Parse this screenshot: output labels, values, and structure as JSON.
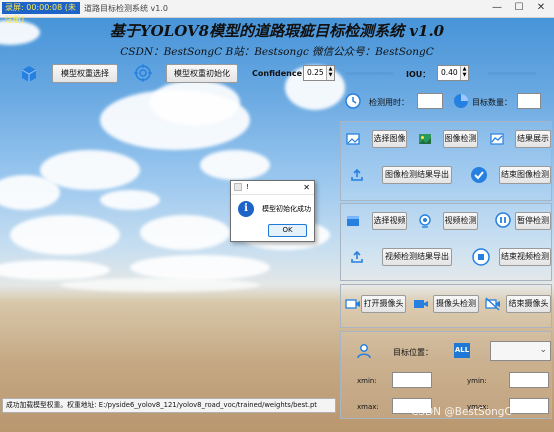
{
  "titlebar": {
    "badge": "录屏: 00:00:08 (未注册)",
    "title": "道路目标检测系统 v1.0",
    "minimize": "—",
    "maximize": "☐",
    "close": "✕"
  },
  "header": {
    "title": "基于YOLOV8模型的道路瑕疵目标检测系统 v1.0",
    "subtitle": "CSDN：BestSongC   B站：Bestsongc   微信公众号：BestSongC"
  },
  "toolbar": {
    "select_weights": "模型权重选择",
    "init_weights": "模型权重初始化",
    "confidence_label": "Confidence",
    "confidence_value": "0.25",
    "iou_label": "IOU：",
    "iou_value": "0.40"
  },
  "stats": {
    "time_label": "检测用时：",
    "count_label": "目标数量："
  },
  "image_panel": {
    "select_image": "选择图像",
    "detect_image": "图像检测",
    "show_result": "结果展示",
    "export_image": "图像检测结果导出",
    "end_image": "结束图像检测"
  },
  "video_panel": {
    "select_video": "选择视频",
    "detect_video": "视频检测",
    "pause_detect": "暂停检测",
    "export_video": "视频检测结果导出",
    "end_video": "结束视频检测"
  },
  "camera_panel": {
    "open_camera": "打开摄像头",
    "camera_detect": "摄像头检测",
    "close_camera": "结束摄像头"
  },
  "target_panel": {
    "position_label": "目标位置：",
    "all_badge": "ALL",
    "xmin": "xmin:",
    "ymin": "ymin:",
    "xmax": "xmax:",
    "ymax": "ymax:"
  },
  "dialog": {
    "title": "!",
    "message": "模型初始化成功",
    "ok": "OK"
  },
  "status": {
    "text": "成功加载模型权重。权重地址: E:/pyside6_yolov8_121/yolov8_road_voc/trained/weights/best.pt"
  },
  "watermark": "CSDN @BestSongC",
  "colors": {
    "accent": "#1e78d6",
    "icon_blue": "#2680e0"
  },
  "icons": [
    "cube-icon",
    "target-icon",
    "clock-icon",
    "pie-icon",
    "image-icon",
    "gallery-icon",
    "chart-icon",
    "upload-icon",
    "check-icon",
    "video-file-icon",
    "video-detect-icon",
    "pause-icon",
    "stop-icon",
    "camera-icon",
    "user-icon",
    "info-icon"
  ]
}
